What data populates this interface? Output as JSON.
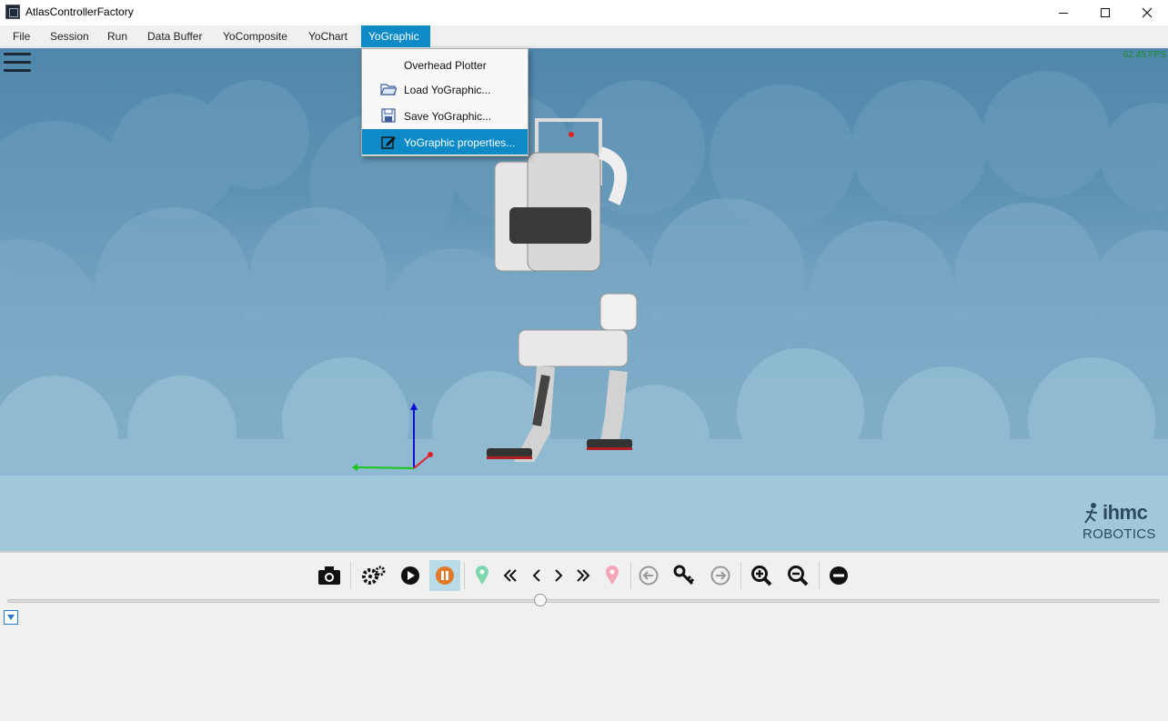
{
  "window": {
    "title": "AtlasControllerFactory",
    "minimize_icon": "minimize-icon",
    "maximize_icon": "maximize-icon",
    "close_icon": "close-icon"
  },
  "menubar": {
    "items": [
      {
        "label": "File"
      },
      {
        "label": "Session"
      },
      {
        "label": "Run"
      },
      {
        "label": "Data Buffer"
      },
      {
        "label": "YoComposite"
      },
      {
        "label": "YoChart"
      },
      {
        "label": "YoGraphic",
        "open": true
      }
    ]
  },
  "yographic_menu": {
    "items": [
      {
        "label": "Overhead Plotter",
        "icon": "none"
      },
      {
        "label": "Load YoGraphic...",
        "icon": "folder-icon"
      },
      {
        "label": "Save YoGraphic...",
        "icon": "floppy-disk-icon"
      },
      {
        "label": "YoGraphic properties...",
        "icon": "edit-icon",
        "highlighted": true
      }
    ]
  },
  "viewport": {
    "fps": "62.45 FPS",
    "logo_top": "ihmc",
    "logo_bottom": "ROBOTICS",
    "sky_color": "#5f93b4",
    "axis_colors": {
      "x": "#e0202a",
      "y": "#19c619",
      "z": "#1010d0"
    }
  },
  "toolbar": {
    "buttons": [
      {
        "icon": "camera-icon"
      },
      {
        "icon": "gears-icon"
      },
      {
        "icon": "play-icon"
      },
      {
        "icon": "pause-icon",
        "pressed": true
      },
      {
        "icon": "in-point-marker-icon"
      },
      {
        "icon": "go-to-in-point-icon"
      },
      {
        "icon": "step-back-icon"
      },
      {
        "icon": "step-forward-icon"
      },
      {
        "icon": "go-to-out-point-icon"
      },
      {
        "icon": "out-point-marker-icon"
      },
      {
        "icon": "previous-key-icon"
      },
      {
        "icon": "key-icon"
      },
      {
        "icon": "next-key-icon"
      },
      {
        "icon": "zoom-in-icon"
      },
      {
        "icon": "zoom-out-icon"
      },
      {
        "icon": "remove-icon"
      }
    ]
  },
  "timeline": {
    "position_fraction": 0.46
  }
}
